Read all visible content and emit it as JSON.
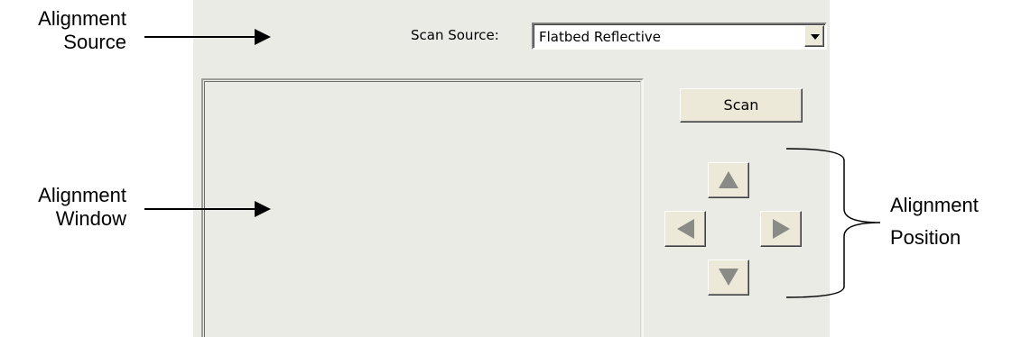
{
  "callouts": {
    "alignment_source": [
      "Alignment",
      "Source"
    ],
    "alignment_window": [
      "Alignment",
      "Window"
    ],
    "alignment_position": [
      "Alignment",
      "Position"
    ]
  },
  "scan_source": {
    "label": "Scan Source:",
    "value": "Flatbed Reflective"
  },
  "scan_button": {
    "label": "Scan"
  },
  "arrows": {
    "up_icon": "triangle-up",
    "left_icon": "triangle-left",
    "right_icon": "triangle-right",
    "down_icon": "triangle-down"
  },
  "colors": {
    "panel": "#ebebe6",
    "button_face": "#ece9d8",
    "arrow_glyph": "#8a8a86"
  }
}
